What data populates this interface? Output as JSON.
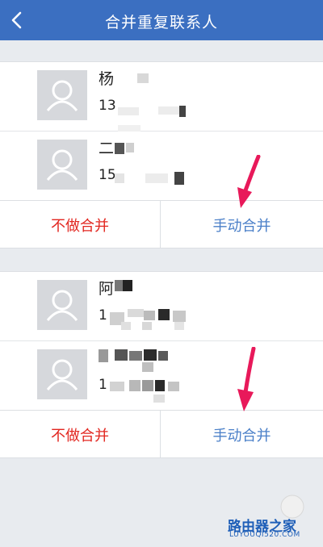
{
  "header": {
    "title": "合并重复联系人"
  },
  "groups": [
    {
      "contacts": [
        {
          "name": "杨",
          "phone": "13"
        },
        {
          "name": "二",
          "phone": "15"
        }
      ],
      "actions": {
        "no_merge": "不做合并",
        "manual_merge": "手动合并"
      }
    },
    {
      "contacts": [
        {
          "name": "阿",
          "phone": "1"
        },
        {
          "name": "",
          "phone": "1"
        }
      ],
      "actions": {
        "no_merge": "不做合并",
        "manual_merge": "手动合并"
      }
    }
  ],
  "watermark": {
    "brand": "路由器之家",
    "url": "LUYOUQI520.COM"
  },
  "colors": {
    "navbar": "#3b6fc1",
    "no_merge": "#e2261f",
    "manual_merge": "#4a7fc8",
    "arrow": "#e8195a"
  }
}
